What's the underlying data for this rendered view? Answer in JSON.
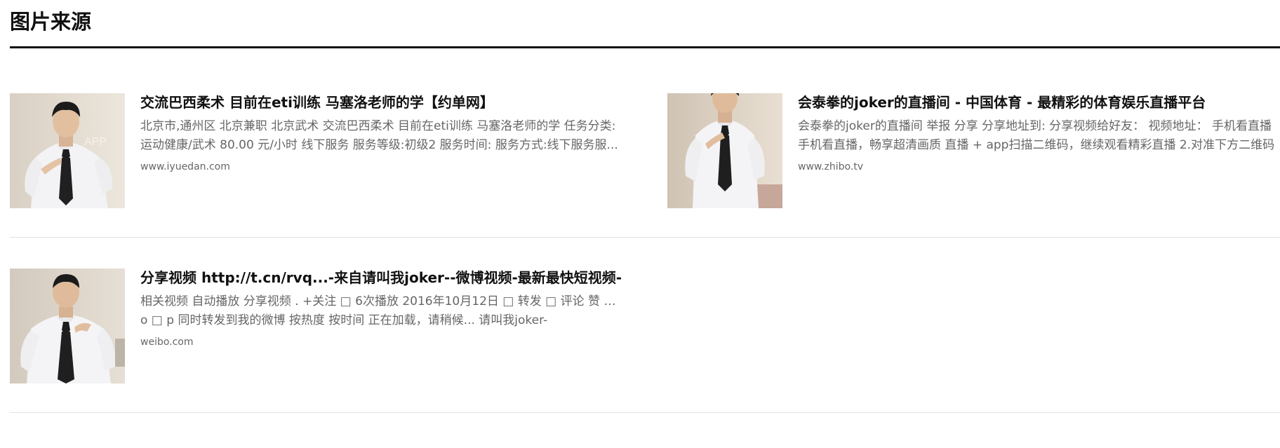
{
  "section": {
    "title": "图片来源"
  },
  "results": [
    {
      "title": "交流巴西柔术 目前在eti训练 马塞洛老师的学【约单网】",
      "desc_line1": "北京市,通州区 北京兼职 北京武术 交流巴西柔术 目前在eti训练 马塞洛老师的学 任务分类:",
      "desc_line2": "运动健康/武术 80.00 元/小时 线下服务 服务等级:初级2 服务时间: 服务方式:线下服务服...",
      "domain": "www.iyuedan.com",
      "thumb_label": "man-in-white-shirt-and-black-tie"
    },
    {
      "title": "会泰拳的joker的直播间 - 中国体育 - 最精彩的体育娱乐直播平台",
      "desc_line1": "会泰拳的joker的直播间 举报 分享 分享地址到: 分享视频给好友： 视频地址： 手机看直播",
      "desc_line2": "手机看直播，畅享超清画质 直播 + app扫描二维码，继续观看精彩直播 2.对准下方二维码",
      "domain": "www.zhibo.tv",
      "thumb_label": "man-in-white-shirt-and-black-tie"
    },
    {
      "title": "分享视频 http://t.cn/rvq...-来自请叫我joker--微博视频-最新最快短视频-",
      "desc_line1": "相关视频 自动播放 分享视频 . +关注 □ 6次播放 2016年10月12日 □ 转发 □ 评论 赞 评论",
      "desc_line2": "o □ p 同时转发到我的微博 按热度 按时间 正在加载，请稍候... 请叫我joker-",
      "domain": "weibo.com",
      "thumb_label": "man-in-white-shirt-and-black-tie"
    }
  ],
  "colors": {
    "title": "#111111",
    "description": "#666666",
    "domain": "#666666",
    "rule": "#111111",
    "divider": "#e2e2e2"
  }
}
